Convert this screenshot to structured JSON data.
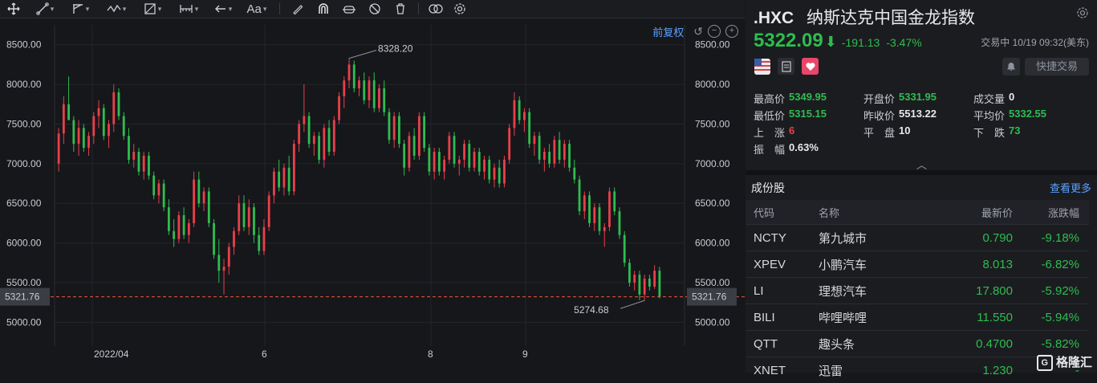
{
  "toolbar": {
    "font_label": "Aa"
  },
  "chart": {
    "adjust_label": "前复权",
    "y_ticks": [
      "8500.00",
      "8000.00",
      "7500.00",
      "7000.00",
      "6500.00",
      "6000.00",
      "5500.00",
      "5000.00"
    ],
    "x_ticks": [
      "2022/04",
      "6",
      "8",
      "9"
    ],
    "current_price_label": "5321.76",
    "high_label": "8328.20",
    "low_label": "5274.68",
    "candle_up_color": "#e8404a",
    "candle_down_color": "#2ebd4f"
  },
  "chart_data": {
    "type": "candlestick",
    "ylim": [
      4700,
      8750
    ],
    "current": 5321.76,
    "high": 8328.2,
    "low": 5274.68,
    "candles": [
      {
        "o": 7000,
        "h": 7450,
        "l": 6900,
        "c": 7380
      },
      {
        "o": 7380,
        "h": 7850,
        "l": 7250,
        "c": 7750
      },
      {
        "o": 7750,
        "h": 8100,
        "l": 7600,
        "c": 7550
      },
      {
        "o": 7550,
        "h": 7600,
        "l": 7150,
        "c": 7250
      },
      {
        "o": 7250,
        "h": 7550,
        "l": 7100,
        "c": 7450
      },
      {
        "o": 7450,
        "h": 7500,
        "l": 7150,
        "c": 7200
      },
      {
        "o": 7200,
        "h": 7400,
        "l": 7100,
        "c": 7350
      },
      {
        "o": 7350,
        "h": 7650,
        "l": 7250,
        "c": 7600
      },
      {
        "o": 7600,
        "h": 7800,
        "l": 7450,
        "c": 7700
      },
      {
        "o": 7700,
        "h": 7750,
        "l": 7300,
        "c": 7350
      },
      {
        "o": 7350,
        "h": 7550,
        "l": 7200,
        "c": 7500
      },
      {
        "o": 7500,
        "h": 8000,
        "l": 7400,
        "c": 7900
      },
      {
        "o": 7900,
        "h": 7950,
        "l": 7550,
        "c": 7600
      },
      {
        "o": 7600,
        "h": 7650,
        "l": 7300,
        "c": 7350
      },
      {
        "o": 7350,
        "h": 7450,
        "l": 7000,
        "c": 7050
      },
      {
        "o": 7050,
        "h": 7250,
        "l": 6950,
        "c": 7150
      },
      {
        "o": 7150,
        "h": 7200,
        "l": 6850,
        "c": 6900
      },
      {
        "o": 6900,
        "h": 7150,
        "l": 6800,
        "c": 7100
      },
      {
        "o": 7100,
        "h": 7150,
        "l": 6800,
        "c": 6850
      },
      {
        "o": 6850,
        "h": 6900,
        "l": 6550,
        "c": 6600
      },
      {
        "o": 6600,
        "h": 6800,
        "l": 6500,
        "c": 6750
      },
      {
        "o": 6750,
        "h": 6800,
        "l": 6400,
        "c": 6450
      },
      {
        "o": 6450,
        "h": 6550,
        "l": 6100,
        "c": 6150
      },
      {
        "o": 6150,
        "h": 6300,
        "l": 5950,
        "c": 6050
      },
      {
        "o": 6050,
        "h": 6400,
        "l": 6000,
        "c": 6350
      },
      {
        "o": 6350,
        "h": 6450,
        "l": 6050,
        "c": 6100
      },
      {
        "o": 6100,
        "h": 6300,
        "l": 6000,
        "c": 6250
      },
      {
        "o": 6250,
        "h": 6900,
        "l": 6200,
        "c": 6800
      },
      {
        "o": 6800,
        "h": 6900,
        "l": 6450,
        "c": 6500
      },
      {
        "o": 6500,
        "h": 6700,
        "l": 6400,
        "c": 6650
      },
      {
        "o": 6650,
        "h": 6700,
        "l": 6200,
        "c": 6250
      },
      {
        "o": 6250,
        "h": 6300,
        "l": 5800,
        "c": 5850
      },
      {
        "o": 5850,
        "h": 6050,
        "l": 5500,
        "c": 5650
      },
      {
        "o": 5650,
        "h": 5800,
        "l": 5350,
        "c": 5700
      },
      {
        "o": 5700,
        "h": 6000,
        "l": 5600,
        "c": 5950
      },
      {
        "o": 5950,
        "h": 6200,
        "l": 5850,
        "c": 6150
      },
      {
        "o": 6150,
        "h": 6600,
        "l": 6100,
        "c": 6500
      },
      {
        "o": 6500,
        "h": 6600,
        "l": 6150,
        "c": 6200
      },
      {
        "o": 6200,
        "h": 6550,
        "l": 6100,
        "c": 6450
      },
      {
        "o": 6450,
        "h": 6500,
        "l": 6000,
        "c": 6100
      },
      {
        "o": 6100,
        "h": 6200,
        "l": 5850,
        "c": 5900
      },
      {
        "o": 5900,
        "h": 6300,
        "l": 5850,
        "c": 6200
      },
      {
        "o": 6200,
        "h": 6650,
        "l": 6150,
        "c": 6600
      },
      {
        "o": 6600,
        "h": 6950,
        "l": 6500,
        "c": 6900
      },
      {
        "o": 6900,
        "h": 7050,
        "l": 6650,
        "c": 6700
      },
      {
        "o": 6700,
        "h": 7000,
        "l": 6600,
        "c": 6950
      },
      {
        "o": 6950,
        "h": 7100,
        "l": 6600,
        "c": 6650
      },
      {
        "o": 6650,
        "h": 7300,
        "l": 6600,
        "c": 7250
      },
      {
        "o": 7250,
        "h": 7550,
        "l": 7150,
        "c": 7500
      },
      {
        "o": 7500,
        "h": 8000,
        "l": 7400,
        "c": 7600
      },
      {
        "o": 7600,
        "h": 7650,
        "l": 7200,
        "c": 7250
      },
      {
        "o": 7250,
        "h": 7400,
        "l": 7100,
        "c": 7350
      },
      {
        "o": 7350,
        "h": 7400,
        "l": 7000,
        "c": 7050
      },
      {
        "o": 7050,
        "h": 7500,
        "l": 6950,
        "c": 7450
      },
      {
        "o": 7450,
        "h": 7550,
        "l": 7100,
        "c": 7150
      },
      {
        "o": 7150,
        "h": 7600,
        "l": 7100,
        "c": 7550
      },
      {
        "o": 7550,
        "h": 7900,
        "l": 7500,
        "c": 7850
      },
      {
        "o": 7850,
        "h": 8100,
        "l": 7700,
        "c": 8050
      },
      {
        "o": 8050,
        "h": 8328,
        "l": 7950,
        "c": 8250
      },
      {
        "o": 8250,
        "h": 8300,
        "l": 7900,
        "c": 7950
      },
      {
        "o": 7950,
        "h": 8100,
        "l": 7850,
        "c": 8050
      },
      {
        "o": 8050,
        "h": 8150,
        "l": 7750,
        "c": 7800
      },
      {
        "o": 7800,
        "h": 8100,
        "l": 7700,
        "c": 8050
      },
      {
        "o": 8050,
        "h": 8150,
        "l": 7650,
        "c": 7700
      },
      {
        "o": 7700,
        "h": 8000,
        "l": 7650,
        "c": 7950
      },
      {
        "o": 7950,
        "h": 8050,
        "l": 7600,
        "c": 7650
      },
      {
        "o": 7650,
        "h": 7700,
        "l": 7250,
        "c": 7300
      },
      {
        "o": 7300,
        "h": 7650,
        "l": 7200,
        "c": 7600
      },
      {
        "o": 7600,
        "h": 7650,
        "l": 7200,
        "c": 7250
      },
      {
        "o": 7250,
        "h": 7300,
        "l": 6850,
        "c": 6950
      },
      {
        "o": 6950,
        "h": 7400,
        "l": 6900,
        "c": 7350
      },
      {
        "o": 7350,
        "h": 7450,
        "l": 7050,
        "c": 7100
      },
      {
        "o": 7100,
        "h": 7650,
        "l": 7050,
        "c": 7600
      },
      {
        "o": 7600,
        "h": 7650,
        "l": 7150,
        "c": 7200
      },
      {
        "o": 7200,
        "h": 7250,
        "l": 6850,
        "c": 6900
      },
      {
        "o": 6900,
        "h": 7200,
        "l": 6800,
        "c": 7150
      },
      {
        "o": 7150,
        "h": 7200,
        "l": 6850,
        "c": 6900
      },
      {
        "o": 6900,
        "h": 7100,
        "l": 6800,
        "c": 7050
      },
      {
        "o": 7050,
        "h": 7400,
        "l": 7000,
        "c": 7350
      },
      {
        "o": 7350,
        "h": 7400,
        "l": 6950,
        "c": 7000
      },
      {
        "o": 7000,
        "h": 7100,
        "l": 6850,
        "c": 7050
      },
      {
        "o": 7050,
        "h": 7300,
        "l": 6950,
        "c": 7250
      },
      {
        "o": 7250,
        "h": 7300,
        "l": 6900,
        "c": 6950
      },
      {
        "o": 6950,
        "h": 7200,
        "l": 6900,
        "c": 7150
      },
      {
        "o": 7150,
        "h": 7200,
        "l": 6850,
        "c": 6900
      },
      {
        "o": 6900,
        "h": 7100,
        "l": 6800,
        "c": 7050
      },
      {
        "o": 7050,
        "h": 7100,
        "l": 6750,
        "c": 6800
      },
      {
        "o": 6800,
        "h": 7000,
        "l": 6700,
        "c": 6950
      },
      {
        "o": 6950,
        "h": 7050,
        "l": 6700,
        "c": 6750
      },
      {
        "o": 6750,
        "h": 7100,
        "l": 6700,
        "c": 7050
      },
      {
        "o": 7050,
        "h": 7500,
        "l": 7000,
        "c": 7450
      },
      {
        "o": 7450,
        "h": 7900,
        "l": 7350,
        "c": 7800
      },
      {
        "o": 7800,
        "h": 7850,
        "l": 7500,
        "c": 7550
      },
      {
        "o": 7550,
        "h": 7700,
        "l": 7400,
        "c": 7650
      },
      {
        "o": 7650,
        "h": 7700,
        "l": 7200,
        "c": 7250
      },
      {
        "o": 7250,
        "h": 7400,
        "l": 7100,
        "c": 7350
      },
      {
        "o": 7350,
        "h": 7400,
        "l": 7000,
        "c": 7050
      },
      {
        "o": 7050,
        "h": 7200,
        "l": 6900,
        "c": 7150
      },
      {
        "o": 7150,
        "h": 7250,
        "l": 6950,
        "c": 7000
      },
      {
        "o": 7000,
        "h": 7350,
        "l": 6950,
        "c": 7300
      },
      {
        "o": 7300,
        "h": 7400,
        "l": 7000,
        "c": 7050
      },
      {
        "o": 7050,
        "h": 7300,
        "l": 6950,
        "c": 7250
      },
      {
        "o": 7250,
        "h": 7300,
        "l": 6900,
        "c": 6950
      },
      {
        "o": 6950,
        "h": 7050,
        "l": 6750,
        "c": 6800
      },
      {
        "o": 6800,
        "h": 6850,
        "l": 6350,
        "c": 6400
      },
      {
        "o": 6400,
        "h": 6650,
        "l": 6300,
        "c": 6600
      },
      {
        "o": 6600,
        "h": 6650,
        "l": 6200,
        "c": 6250
      },
      {
        "o": 6250,
        "h": 6500,
        "l": 6150,
        "c": 6450
      },
      {
        "o": 6450,
        "h": 6500,
        "l": 6100,
        "c": 6150
      },
      {
        "o": 6150,
        "h": 6250,
        "l": 5950,
        "c": 6200
      },
      {
        "o": 6200,
        "h": 6700,
        "l": 6150,
        "c": 6650
      },
      {
        "o": 6650,
        "h": 6700,
        "l": 6350,
        "c": 6400
      },
      {
        "o": 6400,
        "h": 6450,
        "l": 6050,
        "c": 6100
      },
      {
        "o": 6100,
        "h": 6150,
        "l": 5700,
        "c": 5750
      },
      {
        "o": 5750,
        "h": 5800,
        "l": 5450,
        "c": 5500
      },
      {
        "o": 5500,
        "h": 5650,
        "l": 5400,
        "c": 5600
      },
      {
        "o": 5600,
        "h": 5650,
        "l": 5280,
        "c": 5350
      },
      {
        "o": 5350,
        "h": 5600,
        "l": 5275,
        "c": 5550
      },
      {
        "o": 5550,
        "h": 5600,
        "l": 5400,
        "c": 5450
      },
      {
        "o": 5450,
        "h": 5720,
        "l": 5420,
        "c": 5650
      },
      {
        "o": 5650,
        "h": 5700,
        "l": 5300,
        "c": 5322
      }
    ]
  },
  "quote": {
    "symbol": ".HXC",
    "name": "纳斯达克中国金龙指数",
    "price": "5322.09",
    "change": "-191.13",
    "change_pct": "-3.47%",
    "status": "交易中 10/19 09:32(美东)",
    "quick_trade": "快捷交易"
  },
  "stats": [
    [
      {
        "label": "最高价",
        "value": "5349.95",
        "color": "green"
      },
      {
        "label": "开盘价",
        "value": "5331.95",
        "color": "green"
      },
      {
        "label": "成交量",
        "value": "0",
        "color": "white"
      }
    ],
    [
      {
        "label": "最低价",
        "value": "5315.15",
        "color": "green"
      },
      {
        "label": "昨收价",
        "value": "5513.22",
        "color": "white"
      },
      {
        "label": "平均价",
        "value": "5332.55",
        "color": "green"
      }
    ],
    [
      {
        "label": "上　涨",
        "value": "6",
        "color": "red"
      },
      {
        "label": "平　盘",
        "value": "10",
        "color": "white"
      },
      {
        "label": "下　跌",
        "value": "73",
        "color": "green"
      }
    ],
    [
      {
        "label": "振　幅",
        "value": "0.63%",
        "color": "white"
      }
    ]
  ],
  "constituents": {
    "title": "成份股",
    "more_label": "查看更多",
    "headers": [
      "代码",
      "名称",
      "最新价",
      "涨跌幅"
    ],
    "rows": [
      {
        "code": "NCTY",
        "name": "第九城市",
        "price": "0.790",
        "pct": "-9.18%"
      },
      {
        "code": "XPEV",
        "name": "小鹏汽车",
        "price": "8.013",
        "pct": "-6.82%"
      },
      {
        "code": "LI",
        "name": "理想汽车",
        "price": "17.800",
        "pct": "-5.92%"
      },
      {
        "code": "BILI",
        "name": "哔哩哔哩",
        "price": "11.550",
        "pct": "-5.94%"
      },
      {
        "code": "QTT",
        "name": "趣头条",
        "price": "0.4700",
        "pct": "-5.82%"
      },
      {
        "code": "XNET",
        "name": "迅雷",
        "price": "1.230",
        "pct": "-"
      }
    ]
  },
  "watermark": "格隆汇"
}
